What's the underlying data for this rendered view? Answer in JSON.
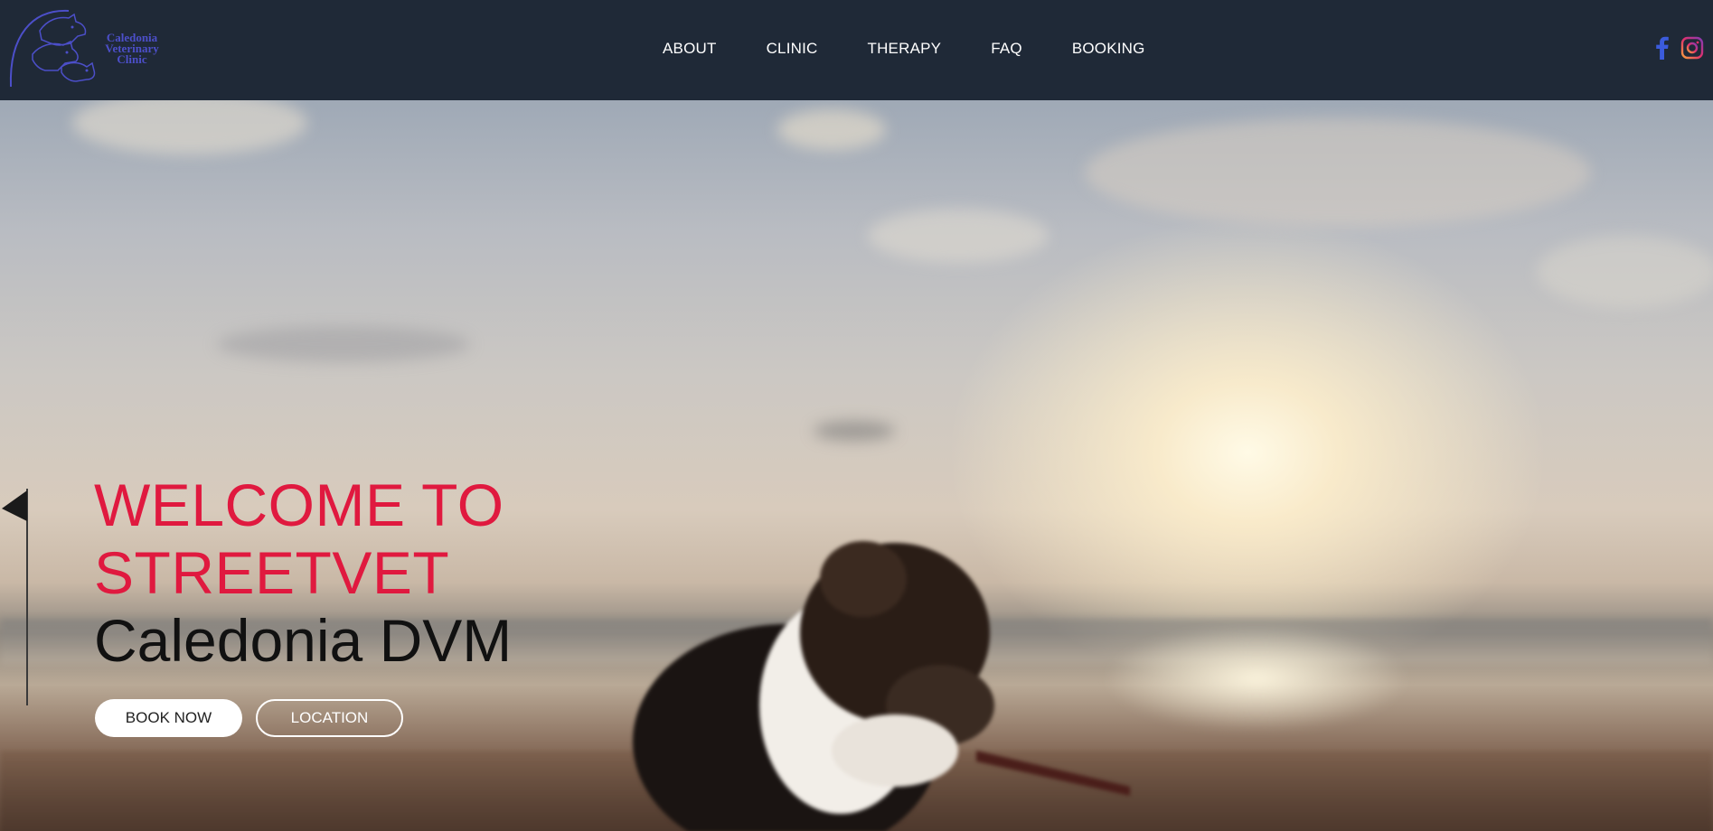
{
  "header": {
    "logo": {
      "lines": [
        "Caledonia",
        "Veterinary",
        "Clinic"
      ]
    },
    "nav": [
      {
        "label": "ABOUT"
      },
      {
        "label": "CLINIC"
      },
      {
        "label": "THERAPY"
      },
      {
        "label": "FAQ"
      },
      {
        "label": "BOOKING"
      }
    ],
    "social": [
      "facebook-icon",
      "instagram-icon"
    ]
  },
  "hero": {
    "title_line1": "WELCOME TO",
    "title_line2": "STREETVET",
    "subtitle": "Caledonia DVM",
    "book_label": "BOOK NOW",
    "location_label": "LOCATION"
  },
  "colors": {
    "header_bg": "#1f2937",
    "accent_red": "#e0193f",
    "logo_purple": "#4c4fc9",
    "facebook_blue": "#3b5bdb"
  }
}
